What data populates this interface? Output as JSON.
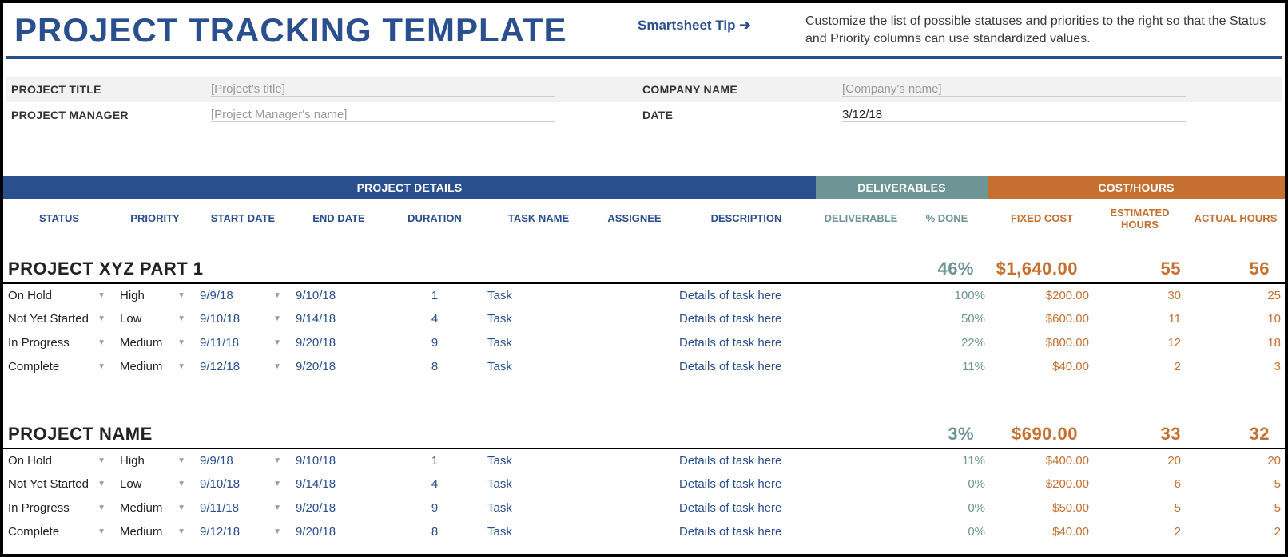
{
  "title": "PROJECT TRACKING TEMPLATE",
  "tip": {
    "link": "Smartsheet Tip",
    "arrow": "➔",
    "text": "Customize the list of possible statuses and priorities to the right so that the Status and Priority columns can use standardized values."
  },
  "meta": {
    "project_title_label": "PROJECT TITLE",
    "project_title_placeholder": "[Project's title]",
    "project_manager_label": "PROJECT MANAGER",
    "project_manager_placeholder": "[Project Manager's name]",
    "company_label": "COMPANY NAME",
    "company_placeholder": "[Company's name]",
    "date_label": "DATE",
    "date_value": "3/12/18"
  },
  "bars": {
    "details": "PROJECT DETAILS",
    "deliverables": "DELIVERABLES",
    "cost": "COST/HOURS"
  },
  "columns": {
    "status": "STATUS",
    "priority": "PRIORITY",
    "start": "START DATE",
    "end": "END DATE",
    "duration": "DURATION",
    "task": "TASK NAME",
    "assignee": "ASSIGNEE",
    "description": "DESCRIPTION",
    "deliverable": "DELIVERABLE",
    "done": "% DONE",
    "cost": "FIXED COST",
    "est": "ESTIMATED HOURS",
    "act": "ACTUAL HOURS"
  },
  "projects": [
    {
      "name": "PROJECT XYZ PART 1",
      "done": "46%",
      "cost": "$1,640.00",
      "est": "55",
      "act": "56",
      "rows": [
        {
          "status": "On Hold",
          "priority": "High",
          "start": "9/9/18",
          "end": "9/10/18",
          "dur": "1",
          "task": "Task",
          "assignee": "",
          "desc": "Details of task here",
          "deliverable": "",
          "done": "100%",
          "cost": "$200.00",
          "est": "30",
          "act": "25"
        },
        {
          "status": "Not Yet Started",
          "priority": "Low",
          "start": "9/10/18",
          "end": "9/14/18",
          "dur": "4",
          "task": "Task",
          "assignee": "",
          "desc": "Details of task here",
          "deliverable": "",
          "done": "50%",
          "cost": "$600.00",
          "est": "11",
          "act": "10"
        },
        {
          "status": "In Progress",
          "priority": "Medium",
          "start": "9/11/18",
          "end": "9/20/18",
          "dur": "9",
          "task": "Task",
          "assignee": "",
          "desc": "Details of task here",
          "deliverable": "",
          "done": "22%",
          "cost": "$800.00",
          "est": "12",
          "act": "18"
        },
        {
          "status": "Complete",
          "priority": "Medium",
          "start": "9/12/18",
          "end": "9/20/18",
          "dur": "8",
          "task": "Task",
          "assignee": "",
          "desc": "Details of task here",
          "deliverable": "",
          "done": "11%",
          "cost": "$40.00",
          "est": "2",
          "act": "3"
        }
      ]
    },
    {
      "name": "PROJECT NAME",
      "done": "3%",
      "cost": "$690.00",
      "est": "33",
      "act": "32",
      "rows": [
        {
          "status": "On Hold",
          "priority": "High",
          "start": "9/9/18",
          "end": "9/10/18",
          "dur": "1",
          "task": "Task",
          "assignee": "",
          "desc": "Details of task here",
          "deliverable": "",
          "done": "11%",
          "cost": "$400.00",
          "est": "20",
          "act": "20"
        },
        {
          "status": "Not Yet Started",
          "priority": "Low",
          "start": "9/10/18",
          "end": "9/14/18",
          "dur": "4",
          "task": "Task",
          "assignee": "",
          "desc": "Details of task here",
          "deliverable": "",
          "done": "0%",
          "cost": "$200.00",
          "est": "6",
          "act": "5"
        },
        {
          "status": "In Progress",
          "priority": "Medium",
          "start": "9/11/18",
          "end": "9/20/18",
          "dur": "9",
          "task": "Task",
          "assignee": "",
          "desc": "Details of task here",
          "deliverable": "",
          "done": "0%",
          "cost": "$50.00",
          "est": "5",
          "act": "5"
        },
        {
          "status": "Complete",
          "priority": "Medium",
          "start": "9/12/18",
          "end": "9/20/18",
          "dur": "8",
          "task": "Task",
          "assignee": "",
          "desc": "Details of task here",
          "deliverable": "",
          "done": "0%",
          "cost": "$40.00",
          "est": "2",
          "act": "2"
        }
      ]
    }
  ]
}
